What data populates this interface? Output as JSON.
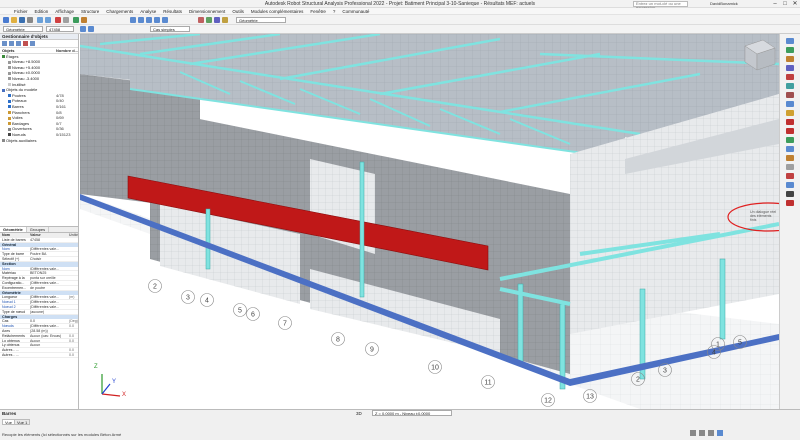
{
  "app": {
    "title": "Autodesk Robot Structural Analysis Professional 2022 - Projet: Batiment Principal 3-10-Sanieque - Résultats MEF: actuels",
    "search_placeholder": "Entrez un mot-clé ou une expression",
    "user": "DavidBonamick",
    "win_min": "–",
    "win_max": "□",
    "win_close": "✕"
  },
  "menu": [
    "Fichier",
    "Edition",
    "Affichage",
    "Structure",
    "Chargements",
    "Analyse",
    "Résultats",
    "Dimensionnement",
    "Outils",
    "Modules complémentaires",
    "Fenêtre",
    "?",
    "Communauté"
  ],
  "toolbar": {
    "structure_type": "Géométrie",
    "node_id": "47458",
    "combo_cases": "Cas simples",
    "combo_view": "Géométrie"
  },
  "object_inspector": {
    "title": "Gestionnaire d'objets",
    "col_object": "Objets",
    "col_count": "Nombre d...",
    "items": [
      {
        "label": "Étages",
        "count": "",
        "color": "#3a8a3a",
        "indent": 0
      },
      {
        "label": "Niveau +8.5000",
        "count": "",
        "color": "#999999",
        "indent": 1
      },
      {
        "label": "Niveau +5.4000",
        "count": "",
        "color": "#999999",
        "indent": 1
      },
      {
        "label": "Niveau ±0.0000",
        "count": "",
        "color": "#999999",
        "indent": 1
      },
      {
        "label": "Niveau -3.4000",
        "count": "",
        "color": "#999999",
        "indent": 1
      },
      {
        "label": "Inutilisé",
        "count": "",
        "color": "#cccccc",
        "indent": 1
      },
      {
        "label": "Objets du modèle",
        "count": "",
        "color": "#4a70c0",
        "indent": 0
      },
      {
        "label": "Poutres",
        "count": "4/78",
        "color": "#2c6fc9",
        "indent": 1
      },
      {
        "label": "Poteaux",
        "count": "0/40",
        "color": "#2c6fc9",
        "indent": 1
      },
      {
        "label": "Barres",
        "count": "0/161",
        "color": "#2c6fc9",
        "indent": 1
      },
      {
        "label": "Planchers",
        "count": "0/8",
        "color": "#cc9933",
        "indent": 1
      },
      {
        "label": "Voiles",
        "count": "0/69",
        "color": "#cc9933",
        "indent": 1
      },
      {
        "label": "Bardages",
        "count": "0/7",
        "color": "#cc9933",
        "indent": 1
      },
      {
        "label": "Ouvertures",
        "count": "0/36",
        "color": "#888888",
        "indent": 1
      },
      {
        "label": "Noeuds",
        "count": "0/15123",
        "color": "#444444",
        "indent": 1
      },
      {
        "label": "Objets auxiliaires",
        "count": "",
        "color": "#888888",
        "indent": 0
      }
    ]
  },
  "geometry_panel": {
    "tabs": [
      "Géométrie",
      "Groupes"
    ],
    "col_name": "Nom",
    "col_value": "Valeur",
    "col_unit": "Unité",
    "list_label": "Liste de barres",
    "list_value": "47458",
    "rows": [
      {
        "type": "section",
        "k": "Général"
      },
      {
        "type": "row",
        "k": "Nom",
        "v": "(Différentes vale...",
        "u": "",
        "blue": true
      },
      {
        "type": "row",
        "k": "Type de barre",
        "v": "Poutre BA",
        "u": "",
        "blue": false
      },
      {
        "type": "row",
        "k": "Sélectif (+)",
        "v": "Choisir",
        "u": "",
        "blue": false
      },
      {
        "type": "section",
        "k": "Section"
      },
      {
        "type": "row",
        "k": "Nom",
        "v": "(Différentes vale...",
        "u": "",
        "blue": true
      },
      {
        "type": "row",
        "k": "Matériau",
        "v": "BETON25",
        "u": "",
        "blue": false
      },
      {
        "type": "row",
        "k": "Repérage à la",
        "v": "punta sur oreille",
        "u": "",
        "blue": false
      },
      {
        "type": "row",
        "k": "Configuratio...",
        "v": "(Différentes vale...",
        "u": "",
        "blue": false
      },
      {
        "type": "row",
        "k": "Excentremen...",
        "v": "de poutre",
        "u": "",
        "blue": false
      },
      {
        "type": "section",
        "k": "Géométrie"
      },
      {
        "type": "row",
        "k": "Longueur",
        "v": "(Différentes vale...",
        "u": "(m)",
        "blue": false
      },
      {
        "type": "row",
        "k": "Noeud 1",
        "v": "(Différentes vale...",
        "u": "",
        "blue": true
      },
      {
        "type": "row",
        "k": "Noeud 2",
        "v": "(Différentes vale...",
        "u": "",
        "blue": true
      },
      {
        "type": "row",
        "k": "Type de nœud",
        "v": "(aucune)",
        "u": "",
        "blue": false
      },
      {
        "type": "section",
        "k": "Charges"
      },
      {
        "type": "row",
        "k": "Cas",
        "v": "0.0",
        "u": "(Deg)",
        "blue": false
      },
      {
        "type": "row",
        "k": "Nœuds",
        "v": "(Différentes vale...",
        "u": "0.0",
        "blue": true
      },
      {
        "type": "row",
        "k": "Axes",
        "v": "(28.58 (m))",
        "u": "",
        "blue": false
      },
      {
        "type": "row",
        "k": "Relâchements",
        "v": "Aucun (cas: Encas)",
        "u": "0.0",
        "blue": false
      },
      {
        "type": "row",
        "k": "Lo obtenus",
        "v": "Aucun",
        "u": "0.0",
        "blue": false
      },
      {
        "type": "row",
        "k": "Ly obtenus",
        "v": "Aucun",
        "u": "",
        "blue": false
      },
      {
        "type": "row",
        "k": "Autres - ...",
        "v": "",
        "u": "0.0",
        "blue": false
      },
      {
        "type": "row",
        "k": "Autres - ...",
        "v": "",
        "u": "0.0",
        "blue": false
      }
    ]
  },
  "viewport": {
    "view_label": "3D",
    "level_combo": "Z = 0.0000 m - Niveau ±0.0000",
    "tooltip": "Un dialogue réel des éléments finis",
    "axis_x": "X",
    "axis_y": "Y",
    "axis_z": "Z",
    "grid_labels": [
      "2",
      "3",
      "4",
      "5",
      "6",
      "7",
      "8",
      "9",
      "10",
      "11",
      "12",
      "13",
      "1",
      "2",
      "3",
      "4",
      "5"
    ]
  },
  "bottom_tabs": {
    "panel_title": "Barres",
    "tab1": "Vue",
    "tab2": "Vue 1",
    "hint": "Recopie les éléments (Ici sélectionnés sur les modules Béton Armé"
  },
  "colors": {
    "wall": "#9a9ea3",
    "wall_dark": "#7d8186",
    "roof": "#b7bec6",
    "cyan": "#7fe3e0",
    "red_beam": "#c01818",
    "highlight": "#e02020"
  }
}
